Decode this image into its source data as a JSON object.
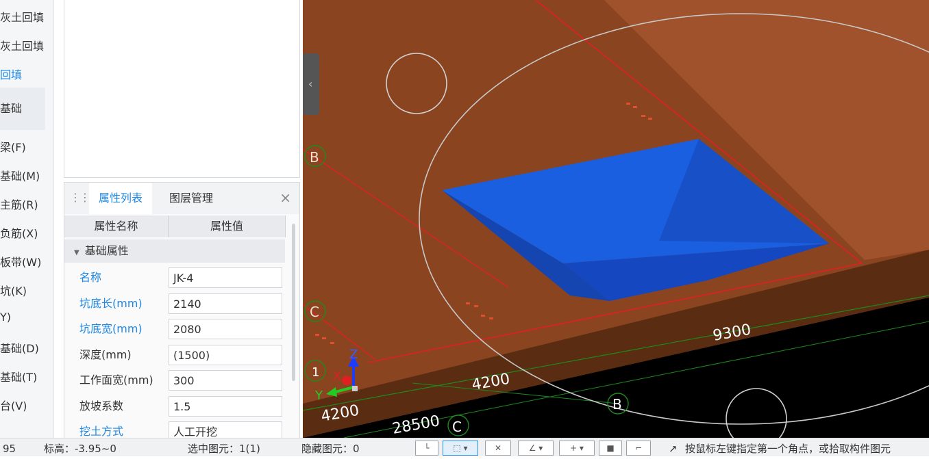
{
  "tree": {
    "items": [
      {
        "label": "灰土回填",
        "active": false
      },
      {
        "label": "灰土回填",
        "active": false
      },
      {
        "label": "回填",
        "active": true
      },
      {
        "label": "基础",
        "active": false,
        "boxed": true
      },
      {
        "label": "梁(F)",
        "active": false
      },
      {
        "label": "基础(M)",
        "active": false
      },
      {
        "label": "主筋(R)",
        "active": false
      },
      {
        "label": "负筋(X)",
        "active": false
      },
      {
        "label": "板带(W)",
        "active": false
      },
      {
        "label": "坑(K)",
        "active": false
      },
      {
        "label": "Y)",
        "active": false
      },
      {
        "label": "基础(D)",
        "active": false
      },
      {
        "label": "基础(T)",
        "active": false
      },
      {
        "label": "台(V)",
        "active": false
      }
    ]
  },
  "panel": {
    "tabs": [
      {
        "label": "属性列表",
        "active": true
      },
      {
        "label": "图层管理",
        "active": false
      }
    ],
    "close_label": "×",
    "columns": [
      "属性名称",
      "属性值"
    ],
    "group_label": "基础属性",
    "rows": [
      {
        "name": "名称",
        "value": "JK-4",
        "blue": true
      },
      {
        "name": "坑底长(mm)",
        "value": "2140",
        "blue": true
      },
      {
        "name": "坑底宽(mm)",
        "value": "2080",
        "blue": true
      },
      {
        "name": "深度(mm)",
        "value": "(1500)",
        "blue": false
      },
      {
        "name": "工作面宽(mm)",
        "value": "300",
        "blue": false
      },
      {
        "name": "放坡系数",
        "value": "1.5",
        "blue": false
      },
      {
        "name": "挖土方式",
        "value": "人工开挖",
        "blue": true
      }
    ]
  },
  "viewport": {
    "axis_labels": {
      "b_left": "B",
      "c_left": "C",
      "one": "1",
      "b_bottom": "B",
      "c_bottom": "C"
    },
    "dimensions": {
      "d9300": "9300",
      "d4200_a": "4200",
      "d4200_b": "4200",
      "d28500": "28500"
    },
    "gizmo": {
      "x": "X",
      "y": "Y",
      "z": "Z"
    },
    "colors": {
      "ground": "#8b4420",
      "pit": "#1a5fe0",
      "grid_red": "#e02020",
      "background": "#000000"
    }
  },
  "status": {
    "coord": "95",
    "elevation": "标高：-3.95~0",
    "selected": "选中图元：1(1)",
    "hidden": "隐藏图元：0",
    "hint": "按鼠标左键指定第一个角点，或拾取构件图元"
  }
}
